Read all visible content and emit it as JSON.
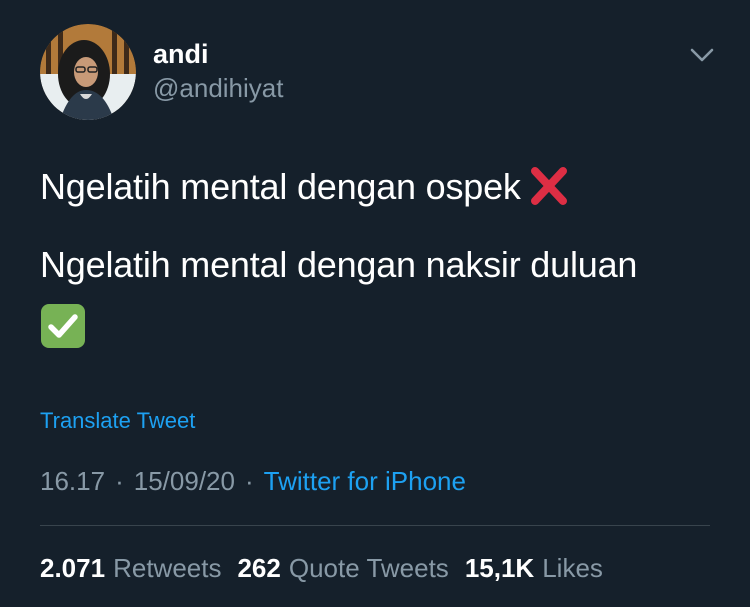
{
  "author": {
    "display_name": "andi",
    "handle": "@andihiyat"
  },
  "tweet": {
    "line1": "Ngelatih mental dengan ospek",
    "line1_emoji": "cross-mark-icon",
    "line2": "Ngelatih mental dengan naksir duluan",
    "line2_emoji": "check-mark-button-icon",
    "translate_label": "Translate Tweet",
    "time": "16.17",
    "separator": "·",
    "date": "15/09/20",
    "source": "Twitter for iPhone"
  },
  "stats": {
    "retweets_count": "2.071",
    "retweets_label": "Retweets",
    "quotes_count": "262",
    "quotes_label": "Quote Tweets",
    "likes_count": "15,1K",
    "likes_label": "Likes"
  },
  "colors": {
    "background": "#15202b",
    "primary_text": "#ffffff",
    "secondary_text": "#8899a6",
    "link": "#1da1f2",
    "divider": "#38444d",
    "cross_red": "#dd2e44",
    "check_green": "#77b255"
  }
}
